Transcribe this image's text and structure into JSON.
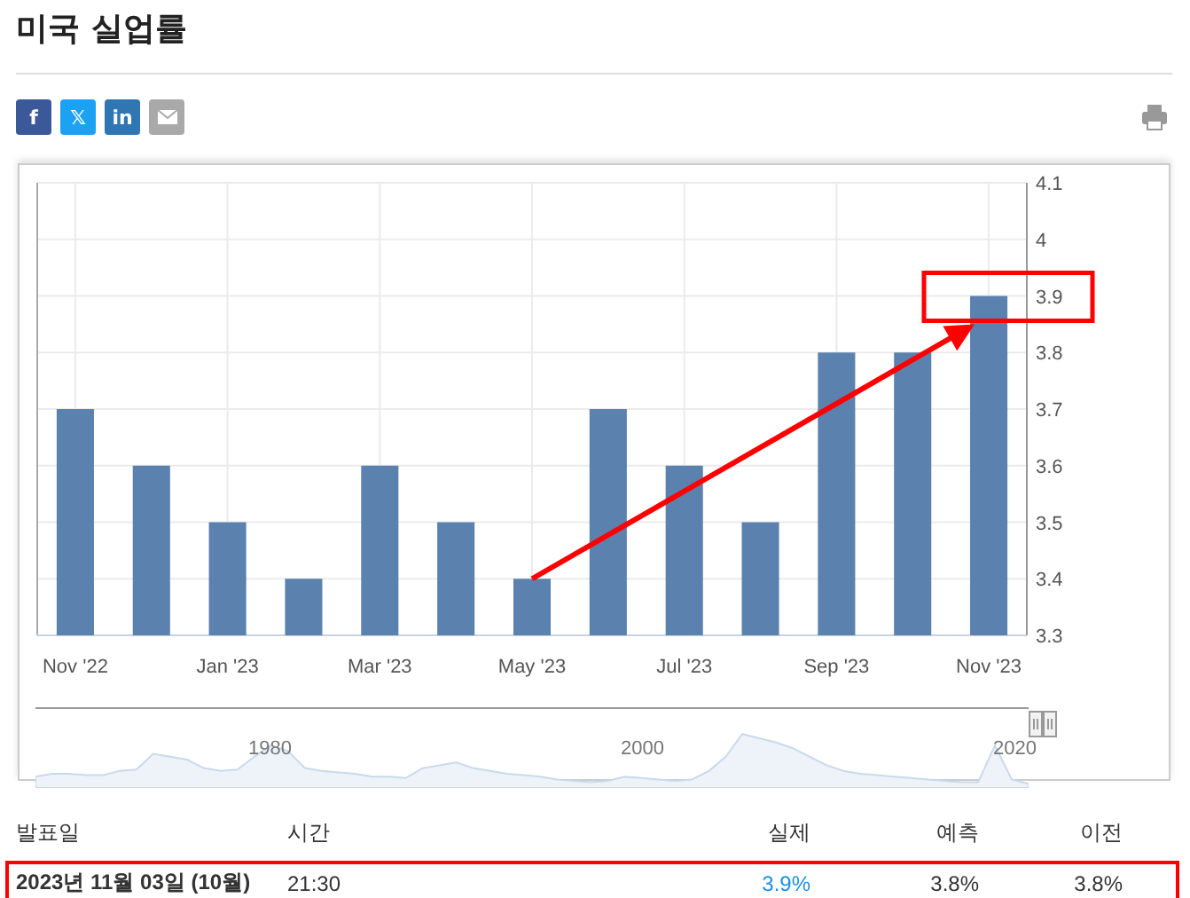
{
  "title": "미국 실업률",
  "share_buttons": [
    {
      "kind": "text",
      "label": "f",
      "color": "#3b5998"
    },
    {
      "kind": "text",
      "label": "𝕏",
      "color": "#1da1f2"
    },
    {
      "kind": "text",
      "label": "in",
      "color": "#2f76b3"
    },
    {
      "kind": "email",
      "color": "#a9a9a9"
    }
  ],
  "chart": {
    "chart_data": {
      "type": "bar",
      "categories": [
        "Nov '22",
        null,
        "Jan '23",
        null,
        "Mar '23",
        null,
        "May '23",
        null,
        "Jul '23",
        null,
        "Sep '23",
        null,
        "Nov '23"
      ],
      "series": [
        {
          "color": "#5b82ae",
          "values": [
            3.7,
            3.6,
            3.5,
            3.4,
            3.6,
            3.5,
            3.4,
            3.7,
            3.6,
            3.5,
            3.8,
            3.8,
            3.9
          ]
        }
      ],
      "ylim": [
        3.3,
        4.1
      ],
      "yticks": [
        {
          "value": 4.1,
          "label": "4.1"
        },
        {
          "value": 4.0,
          "label": "4"
        },
        {
          "value": 3.9,
          "label": "3.9"
        },
        {
          "value": 3.8,
          "label": "3.8"
        },
        {
          "value": 3.7,
          "label": "3.7"
        },
        {
          "value": 3.6,
          "label": "3.6"
        },
        {
          "value": 3.5,
          "label": "3.5"
        },
        {
          "value": 3.4,
          "label": "3.4"
        },
        {
          "value": 3.3,
          "label": "3.3"
        }
      ],
      "grid": true
    },
    "rising_arrow": true,
    "latest_value_boxed": true,
    "navigator": {
      "labels": [
        "1980",
        "2000",
        "2020"
      ]
    }
  },
  "table": {
    "columns": [
      "발표일",
      "시간",
      "실제",
      "예측",
      "이전"
    ],
    "rows": [
      {
        "date": "2023년 11월 03일 (10월)",
        "time": "21:30",
        "actual": "3.9%",
        "forecast": "3.8%",
        "previous": "3.8%",
        "highlighted": true
      }
    ]
  }
}
